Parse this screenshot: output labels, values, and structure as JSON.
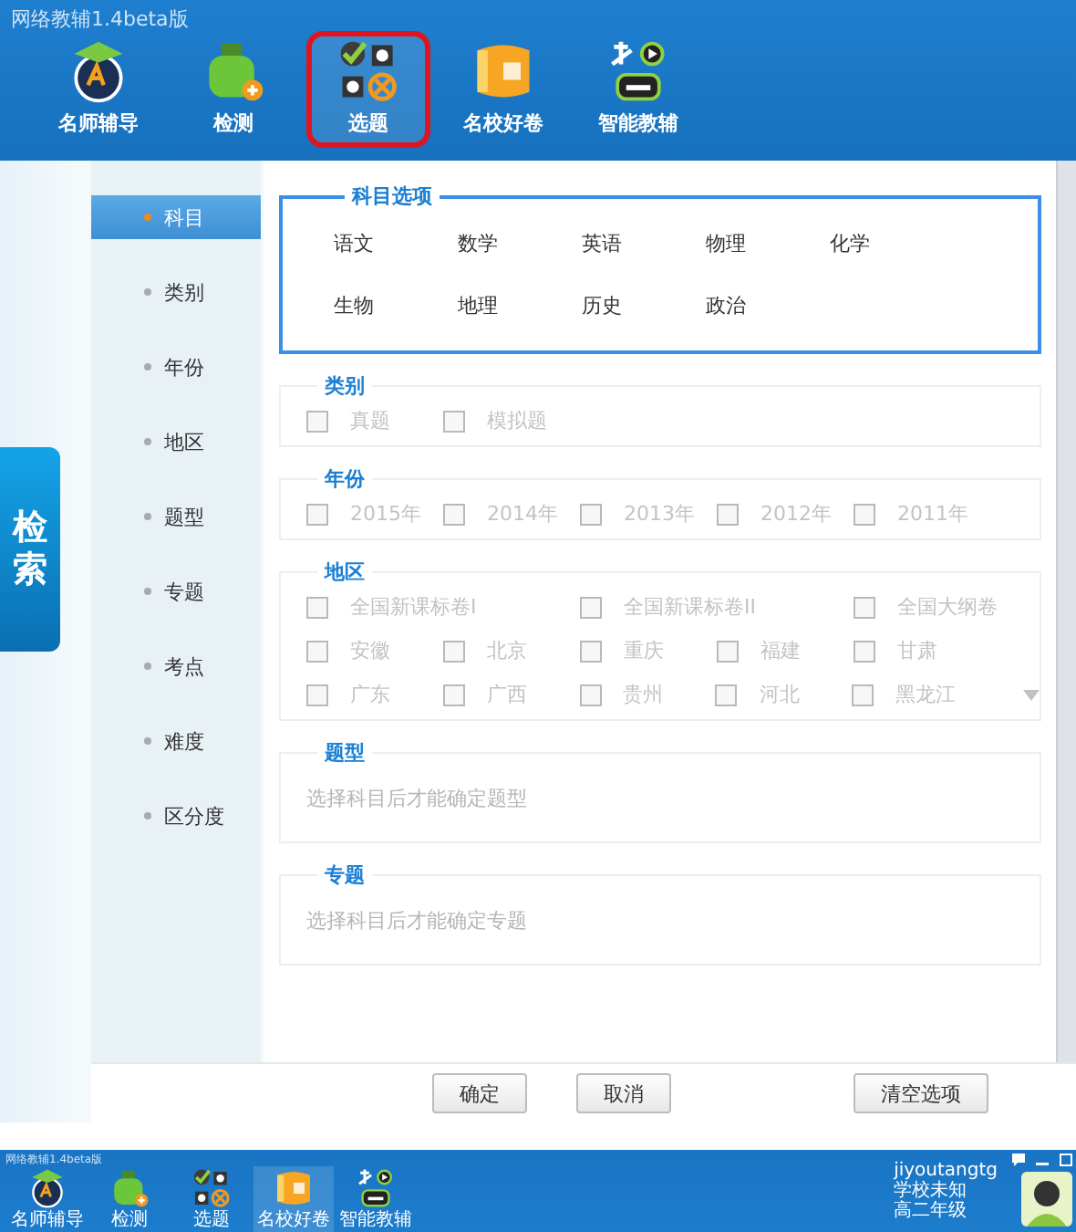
{
  "window": {
    "title": "网络教辅1.4beta版"
  },
  "toolbar": [
    {
      "label": "名师辅导",
      "kind": "tutor",
      "selected": false
    },
    {
      "label": "检测",
      "kind": "test",
      "selected": false
    },
    {
      "label": "选题",
      "kind": "select",
      "selected": true
    },
    {
      "label": "名校好卷",
      "kind": "paper",
      "selected": false
    },
    {
      "label": "智能教辅",
      "kind": "smart",
      "selected": false
    }
  ],
  "side_tab": {
    "label": "检索"
  },
  "sidebar": {
    "items": [
      {
        "label": "科目",
        "selected": true
      },
      {
        "label": "类别",
        "selected": false
      },
      {
        "label": "年份",
        "selected": false
      },
      {
        "label": "地区",
        "selected": false
      },
      {
        "label": "题型",
        "selected": false
      },
      {
        "label": "专题",
        "selected": false
      },
      {
        "label": "考点",
        "selected": false
      },
      {
        "label": "难度",
        "selected": false
      },
      {
        "label": "区分度",
        "selected": false
      }
    ]
  },
  "subjects": {
    "title": "科目选项",
    "rows": [
      [
        {
          "label": "语文",
          "selected": false
        },
        {
          "label": "数学",
          "selected": false
        },
        {
          "label": "英语",
          "selected": false
        },
        {
          "label": "物理",
          "selected": false
        },
        {
          "label": "化学",
          "selected": false
        }
      ],
      [
        {
          "label": "生物",
          "selected": false
        },
        {
          "label": "地理",
          "selected": false
        },
        {
          "label": "历史",
          "selected": false
        },
        {
          "label": "政治",
          "selected": false
        }
      ]
    ]
  },
  "category": {
    "title": "类别",
    "disabled": true,
    "rows": [
      [
        {
          "label": "真题",
          "checked": false
        },
        {
          "label": "模拟题",
          "checked": false
        }
      ]
    ]
  },
  "year": {
    "title": "年份",
    "disabled": true,
    "rows": [
      [
        {
          "label": "2015年",
          "checked": false
        },
        {
          "label": "2014年",
          "checked": false
        },
        {
          "label": "2013年",
          "checked": false
        },
        {
          "label": "2012年",
          "checked": false
        },
        {
          "label": "2011年",
          "checked": false
        }
      ]
    ]
  },
  "region": {
    "title": "地区",
    "disabled": true,
    "rows": [
      [
        {
          "label": "全国新课标卷I",
          "checked": false
        },
        "",
        {
          "label": "全国新课标卷II",
          "checked": false
        },
        "",
        {
          "label": "全国大纲卷",
          "checked": false
        }
      ],
      [
        {
          "label": "安徽",
          "checked": false
        },
        {
          "label": "北京",
          "checked": false
        },
        {
          "label": "重庆",
          "checked": false
        },
        {
          "label": "福建",
          "checked": false
        },
        {
          "label": "甘肃",
          "checked": false
        }
      ],
      [
        {
          "label": "广东",
          "checked": false
        },
        {
          "label": "广西",
          "checked": false
        },
        {
          "label": "贵州",
          "checked": false
        },
        {
          "label": "河北",
          "checked": false
        },
        {
          "label": "黑龙江",
          "checked": false
        }
      ]
    ]
  },
  "question_type": {
    "title": "题型",
    "hint": "选择科目后才能确定题型"
  },
  "topic": {
    "title": "专题",
    "hint": "选择科目后才能确定专题"
  },
  "buttons": [
    {
      "label": "确定"
    },
    {
      "label": "取消"
    },
    {
      "label": "清空选项"
    }
  ],
  "taskbar": {
    "title": "网络教辅1.4beta版",
    "items": [
      {
        "label": "名师辅导",
        "kind": "tutor",
        "selected": false
      },
      {
        "label": "检测",
        "kind": "test",
        "selected": false
      },
      {
        "label": "选题",
        "kind": "select",
        "selected": false
      },
      {
        "label": "名校好卷",
        "kind": "paper",
        "selected": true
      },
      {
        "label": "智能教辅",
        "kind": "smart",
        "selected": false
      }
    ],
    "user": {
      "name": "jiyoutangtg",
      "school": "学校未知",
      "grade": "高二年级"
    }
  }
}
